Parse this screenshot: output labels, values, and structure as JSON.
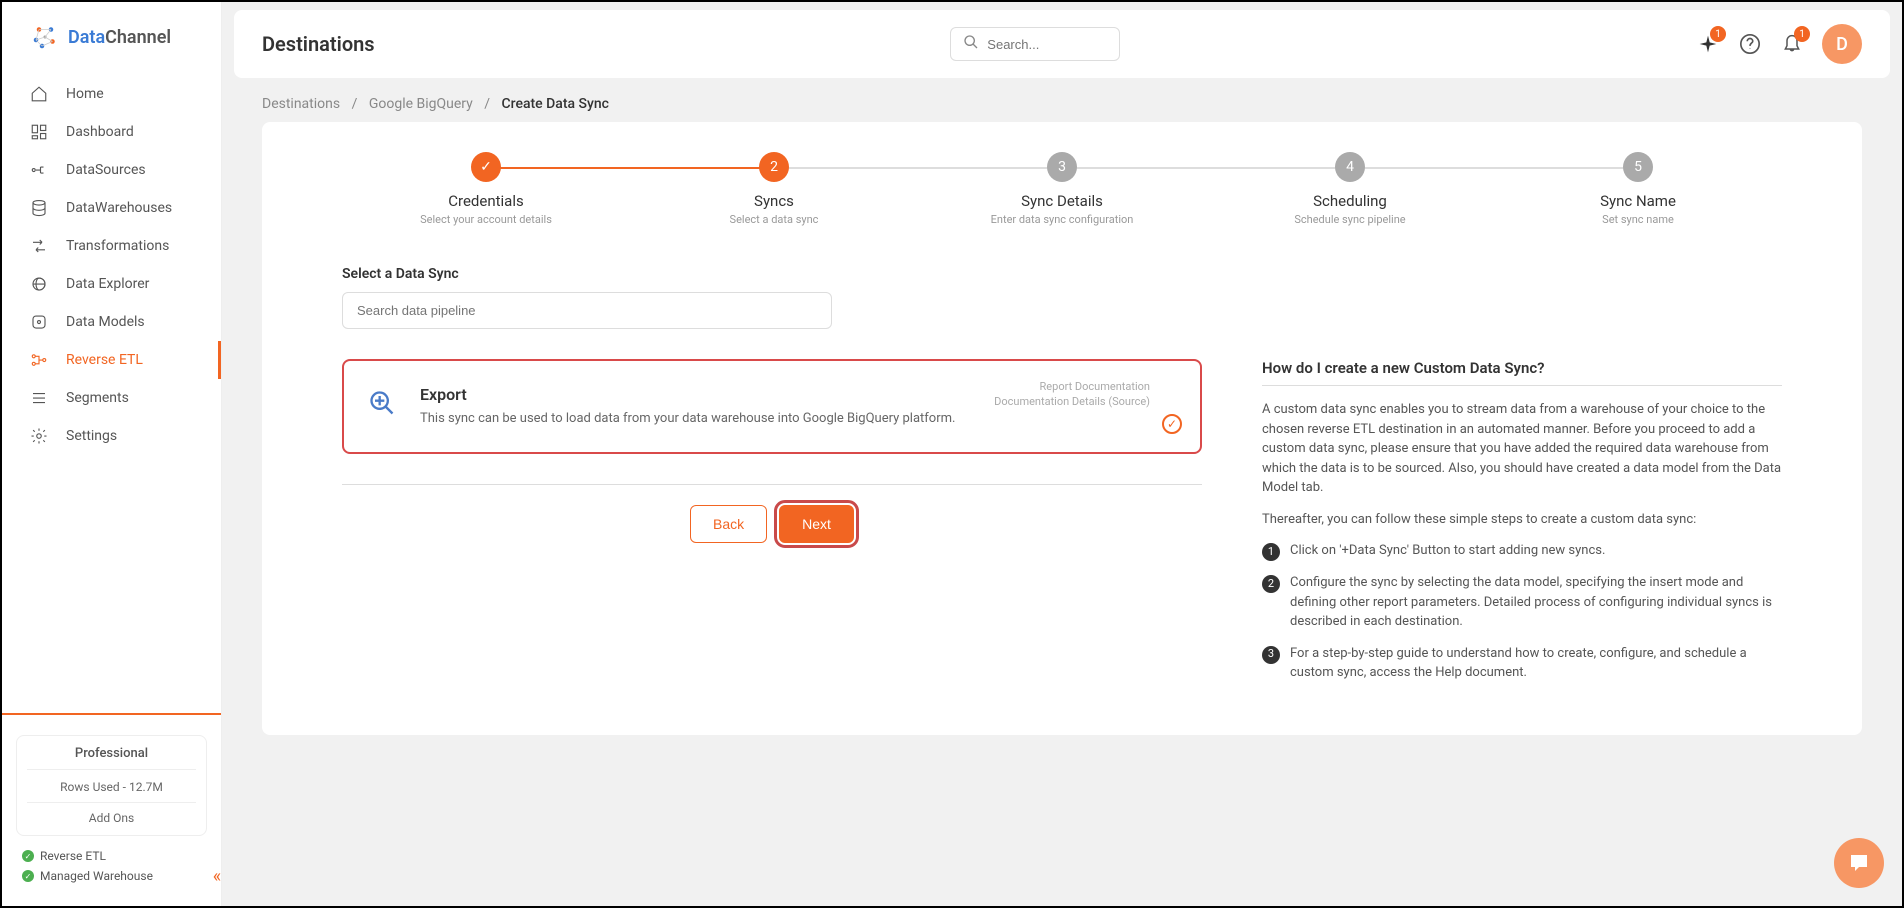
{
  "brand": {
    "part1": "Data",
    "part2": "Channel"
  },
  "sidebar": {
    "items": [
      {
        "label": "Home"
      },
      {
        "label": "Dashboard"
      },
      {
        "label": "DataSources"
      },
      {
        "label": "DataWarehouses"
      },
      {
        "label": "Transformations"
      },
      {
        "label": "Data Explorer"
      },
      {
        "label": "Data Models"
      },
      {
        "label": "Reverse ETL"
      },
      {
        "label": "Segments"
      },
      {
        "label": "Settings"
      }
    ],
    "plan": {
      "name": "Professional",
      "rows": "Rows Used - 12.7M",
      "addons_label": "Add Ons"
    },
    "addons": [
      {
        "label": "Reverse ETL"
      },
      {
        "label": "Managed Warehouse"
      }
    ]
  },
  "header": {
    "title": "Destinations",
    "search_placeholder": "Search...",
    "sparkle_badge": "1",
    "bell_badge": "1",
    "avatar_initial": "D"
  },
  "breadcrumb": {
    "items": [
      "Destinations",
      "Google BigQuery",
      "Create Data Sync"
    ],
    "sep": "/"
  },
  "stepper": [
    {
      "title": "Credentials",
      "sub": "Select your account details",
      "state": "done",
      "icon": "✓"
    },
    {
      "title": "Syncs",
      "sub": "Select a data sync",
      "state": "active",
      "icon": "2"
    },
    {
      "title": "Sync Details",
      "sub": "Enter data sync configuration",
      "state": "pending",
      "icon": "3"
    },
    {
      "title": "Scheduling",
      "sub": "Schedule sync pipeline",
      "state": "pending",
      "icon": "4"
    },
    {
      "title": "Sync Name",
      "sub": "Set sync name",
      "state": "pending",
      "icon": "5"
    }
  ],
  "section": {
    "select_title": "Select a Data Sync",
    "search_placeholder": "Search data pipeline"
  },
  "sync_card": {
    "title": "Export",
    "desc": "This sync can be used to load data from your data warehouse into Google BigQuery platform.",
    "link1": "Report Documentation",
    "link2": "Documentation Details (Source)"
  },
  "buttons": {
    "back": "Back",
    "next": "Next"
  },
  "help": {
    "title": "How do I create a new Custom Data Sync?",
    "para1": "A custom data sync enables you to stream data from a warehouse of your choice to the chosen reverse ETL destination in an automated manner. Before you proceed to add a custom data sync, please ensure that you have added the required data warehouse from which the data is to be sourced. Also, you should have created a data model from the Data Model tab.",
    "para2": "Thereafter, you can follow these simple steps to create a custom data sync:",
    "steps": [
      "Click on '+Data Sync' Button to start adding new syncs.",
      "Configure the sync by selecting the data model, specifying the insert mode and defining other report parameters. Detailed process of configuring individual syncs is described in each destination.",
      "For a step-by-step guide to understand how to create, configure, and schedule a custom sync, access the Help document."
    ]
  }
}
